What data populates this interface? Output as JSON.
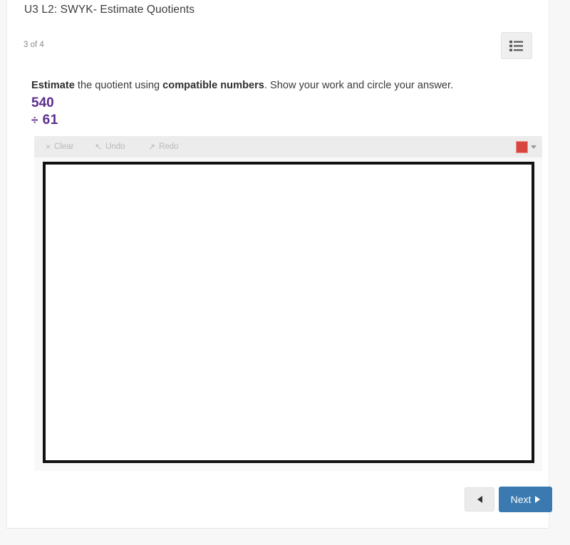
{
  "header": {
    "lesson_title": "U3 L2: SWYK- Estimate Quotients",
    "page_counter": "3 of 4",
    "list_toggle_icon": "list-icon"
  },
  "question": {
    "prompt_part1": "Estimate",
    "prompt_part2": " the quotient using ",
    "prompt_part3": "compatible numbers",
    "prompt_part4": ". Show your work and circle your answer.",
    "dividend": "540",
    "division_symbol": "÷",
    "divisor": "61",
    "accent_color": "#5b2d8e"
  },
  "drawing": {
    "toolbar": {
      "clear_label": "Clear",
      "clear_icon": "×",
      "undo_label": "Undo",
      "undo_icon": "↖",
      "redo_label": "Redo",
      "redo_icon": "↗",
      "selected_color": "#d9453f",
      "caret_icon": "chevron-down-icon"
    },
    "canvas_placeholder": ""
  },
  "footer": {
    "prev_label": "",
    "prev_icon": "triangle-left-icon",
    "next_label": "Next",
    "next_icon": "triangle-right-icon",
    "next_color": "#3b7ab0"
  }
}
